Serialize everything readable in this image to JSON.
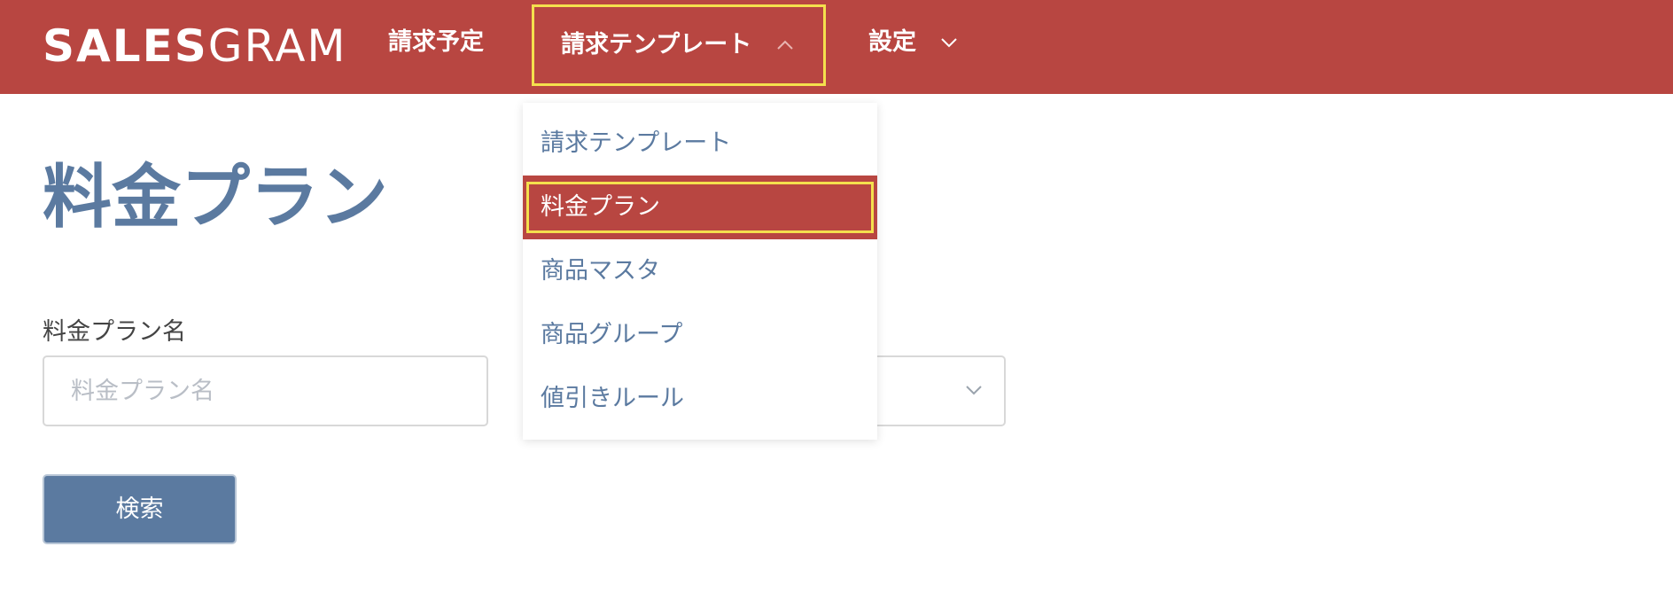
{
  "brand": {
    "logo_bold": "SALES",
    "logo_light": "GRAM"
  },
  "nav": {
    "schedule": "請求予定",
    "template": "請求テンプレート",
    "settings": "設定"
  },
  "dropdown": {
    "items": [
      {
        "label": "請求テンプレート"
      },
      {
        "label": "料金プラン"
      },
      {
        "label": "商品マスタ"
      },
      {
        "label": "商品グループ"
      },
      {
        "label": "値引きルール"
      }
    ],
    "active_index": 1
  },
  "page": {
    "title": "料金プラン"
  },
  "form": {
    "plan_name_label": "料金プラン名",
    "plan_name_placeholder": "料金プラン名",
    "plan_name_value": "",
    "search_button": "検索"
  },
  "icons": {
    "template_chevron": "chevron-up-icon",
    "settings_chevron": "chevron-down-icon",
    "select_chevron": "chevron-down-icon"
  },
  "colors": {
    "brand_red": "#b84641",
    "accent_blue": "#5b7aa0",
    "highlight_yellow": "#f4e04d"
  }
}
